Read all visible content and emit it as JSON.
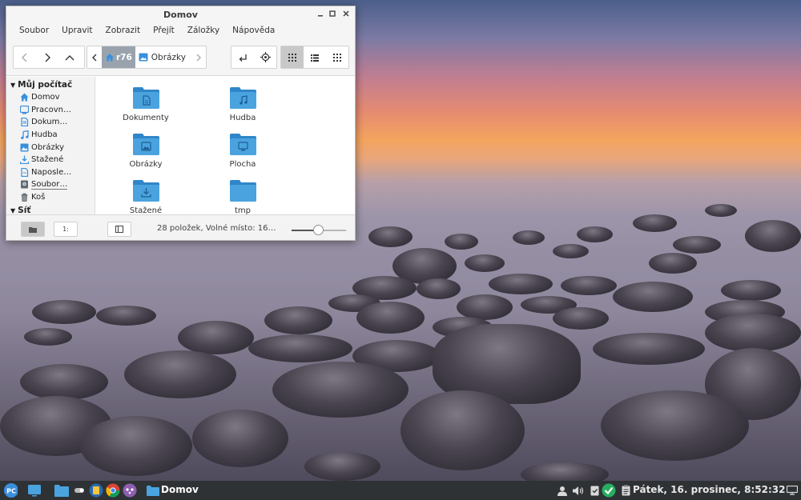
{
  "window": {
    "title": "Domov",
    "menu": [
      "Soubor",
      "Upravit",
      "Zobrazit",
      "Přejít",
      "Záložky",
      "Nápověda"
    ],
    "breadcrumbs": [
      "r76",
      "Obrázky"
    ]
  },
  "sidebar": {
    "sections": [
      {
        "heading": "Můj počítač",
        "items": [
          {
            "label": "Domov",
            "icon": "home-icon"
          },
          {
            "label": "Pracovn…",
            "icon": "desktop-icon"
          },
          {
            "label": "Dokum…",
            "icon": "document-icon"
          },
          {
            "label": "Hudba",
            "icon": "music-icon"
          },
          {
            "label": "Obrázky",
            "icon": "picture-icon"
          },
          {
            "label": "Stažené",
            "icon": "download-icon"
          },
          {
            "label": "Naposle…",
            "icon": "recent-icon"
          },
          {
            "label": "Soubor…",
            "icon": "filesystem-icon"
          },
          {
            "label": "Koš",
            "icon": "trash-icon"
          }
        ]
      },
      {
        "heading": "Síť",
        "items": []
      }
    ]
  },
  "files": [
    {
      "name": "Dokumenty",
      "emblem": "document-icon"
    },
    {
      "name": "Hudba",
      "emblem": "music-icon"
    },
    {
      "name": "Obrázky",
      "emblem": "picture-icon"
    },
    {
      "name": "Plocha",
      "emblem": "desktop-icon"
    },
    {
      "name": "Stažené",
      "emblem": "download-icon"
    },
    {
      "name": "tmp",
      "emblem": ""
    }
  ],
  "status": {
    "text": "28 položek, Volné místo: 16…",
    "sidebar_toggle_labels": [
      "",
      "1:"
    ],
    "zoom_level": 0.5
  },
  "taskbar": {
    "menu_label": "PC",
    "window_title": "Domov",
    "clock": "Pátek, 16. prosinec,   8:52:32"
  },
  "colors": {
    "folder": "#4aa3df",
    "folder_dark": "#2f86c8",
    "accent": "#3a8fdc",
    "taskbar": "#2f3235"
  }
}
